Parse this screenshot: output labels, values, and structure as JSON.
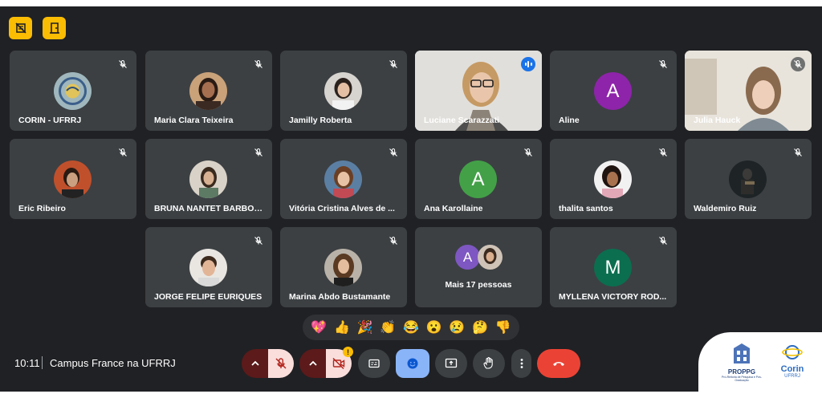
{
  "meeting": {
    "time": "10:11",
    "title": "Campus France na UFRRJ"
  },
  "top_icons": [
    "hide-tiles-icon",
    "leave-door-icon"
  ],
  "participants": [
    {
      "name": "CORIN - UFRRJ",
      "type": "photo",
      "muted": true
    },
    {
      "name": "Maria Clara Teixeira",
      "type": "photo",
      "muted": true
    },
    {
      "name": "Jamilly Roberta",
      "type": "photo",
      "muted": true
    },
    {
      "name": "Luciane Scarazzati",
      "type": "video",
      "muted": false,
      "speaking": true
    },
    {
      "name": "Aline",
      "type": "letter",
      "letter": "A",
      "color": "#8e24aa",
      "muted": true
    },
    {
      "name": "Julia Hauck",
      "type": "video",
      "muted": true
    },
    {
      "name": "Eric Ribeiro",
      "type": "photo",
      "muted": true
    },
    {
      "name": "BRUNA NANTET BARBOSA",
      "type": "photo",
      "muted": true
    },
    {
      "name": "Vitória Cristina Alves de ...",
      "type": "photo",
      "muted": true
    },
    {
      "name": "Ana Karollaine",
      "type": "letter",
      "letter": "A",
      "color": "#43a047",
      "muted": true
    },
    {
      "name": "thalita santos",
      "type": "photo",
      "muted": true
    },
    {
      "name": "Waldemiro Ruiz",
      "type": "photo",
      "muted": true
    },
    {
      "name": "JORGE FELIPE EURIQUES",
      "type": "photo",
      "muted": true
    },
    {
      "name": "Marina Abdo Bustamante",
      "type": "photo",
      "muted": true
    },
    {
      "name": "Mais 17 pessoas",
      "type": "group",
      "letter": "A",
      "color": "#7e57c2"
    },
    {
      "name": "MYLLENA VICTORY ROD...",
      "type": "letter",
      "letter": "M",
      "color": "#0b6e4f",
      "muted": true
    }
  ],
  "reactions": [
    "💖",
    "👍",
    "🎉",
    "👏",
    "😂",
    "😮",
    "😢",
    "🤔",
    "👎"
  ],
  "controls": {
    "mic_options": "mic-options-chevron-icon",
    "mic": "mic-off-icon",
    "cam_options": "camera-options-chevron-icon",
    "cam": "camera-off-icon",
    "cam_alert": "!",
    "captions": "captions-icon",
    "emoji": "emoji-icon",
    "present": "present-icon",
    "hand": "raise-hand-icon",
    "more": "more-options-icon",
    "end": "end-call-icon"
  },
  "colors": {
    "background": "#202124",
    "tile": "#3c4043",
    "danger": "#ea4335",
    "accent": "#8ab4f8",
    "warning": "#fbbc04"
  },
  "logos": {
    "proppg": "PROPPG",
    "proppg_sub": "Pró-Reitoria de Pesquisa e Pós-Graduação",
    "corin": "Corin",
    "corin_sub": "UFRRJ"
  }
}
